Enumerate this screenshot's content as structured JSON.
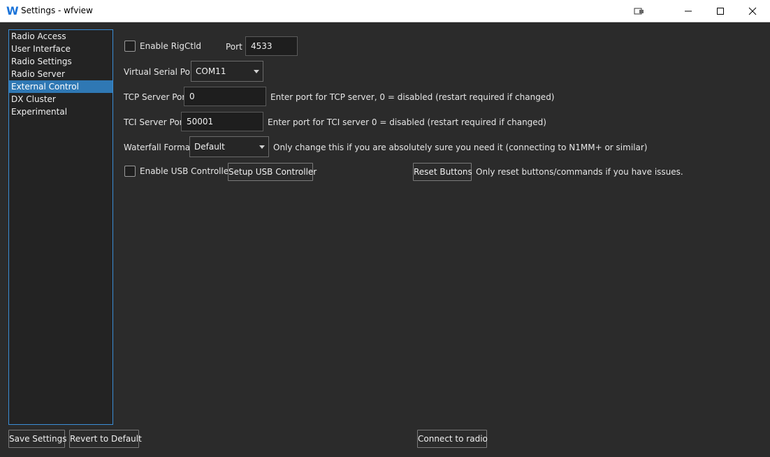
{
  "window": {
    "title": "Settings - wfview",
    "logo_letter": "W"
  },
  "titlebar_icons": {
    "extra": "window-snap-icon",
    "minimize": "minimize-icon",
    "maximize": "maximize-icon",
    "close": "close-icon"
  },
  "sidebar": {
    "items": [
      {
        "label": "Radio Access"
      },
      {
        "label": "User Interface"
      },
      {
        "label": "Radio Settings"
      },
      {
        "label": "Radio Server"
      },
      {
        "label": "External Control",
        "selected": true
      },
      {
        "label": "DX Cluster"
      },
      {
        "label": "Experimental"
      }
    ]
  },
  "rigctld": {
    "checkbox_label": "Enable RigCtld",
    "checked": false,
    "port_label": "Port",
    "port_value": "4533"
  },
  "virtual_serial": {
    "label": "Virtual Serial Port",
    "value": "COM11"
  },
  "tcp_server": {
    "label": "TCP Server Port",
    "value": "0",
    "hint": "Enter port for TCP server, 0 = disabled (restart required if changed)"
  },
  "tci_server": {
    "label": "TCI Server Port",
    "value": "50001",
    "hint": "Enter port for TCI server 0 = disabled (restart required if changed)"
  },
  "waterfall": {
    "label": "Waterfall Format",
    "value": "Default",
    "hint": "Only change this if you are absolutely sure you need it (connecting to N1MM+ or similar)"
  },
  "usb": {
    "checkbox_label": "Enable USB Controllers",
    "checked": false,
    "setup_button": "Setup USB Controller",
    "reset_button": "Reset Buttons",
    "reset_hint": "Only reset buttons/commands if you have issues."
  },
  "footer": {
    "save_button": "Save Settings",
    "revert_button": "Revert to Default",
    "connect_button": "Connect to radio"
  },
  "colors": {
    "background": "#2b2b2b",
    "accent": "#3b8ed6",
    "selected": "#2f78b4",
    "logo": "#1a73d9"
  }
}
